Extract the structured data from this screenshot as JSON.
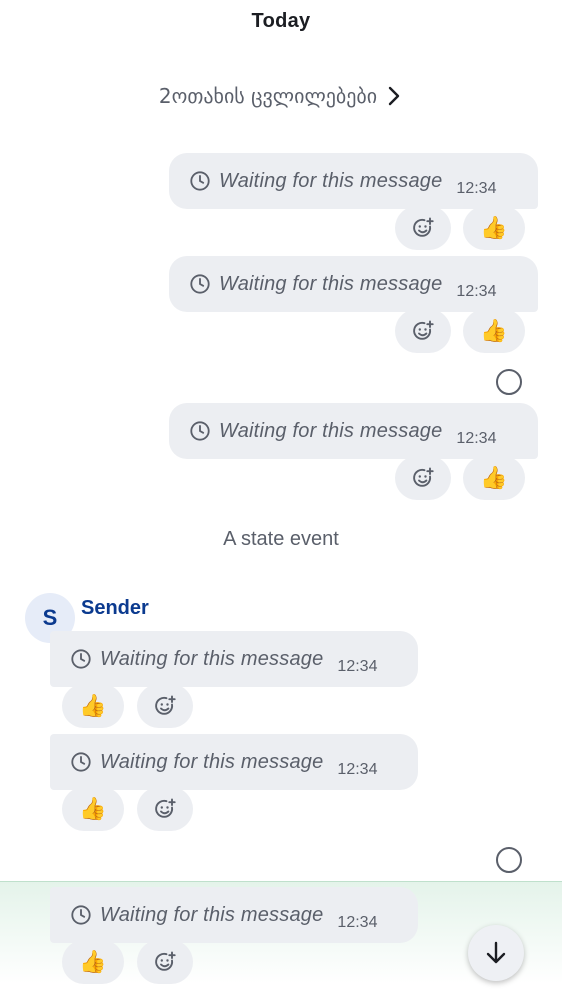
{
  "timeline": {
    "day_separator": "Today",
    "group_summary": "2ოთახის ცვლილებები",
    "state_event": "A state event",
    "sender_name": "Sender",
    "sender_initial": "S"
  },
  "messages": [
    {
      "text": "Waiting for this message",
      "time": "12:34",
      "reaction": "👍"
    },
    {
      "text": "Waiting for this message",
      "time": "12:34",
      "reaction": "👍"
    },
    {
      "text": "Waiting for this message",
      "time": "12:34",
      "reaction": "👍"
    },
    {
      "text": "Waiting for this message",
      "time": "12:34",
      "reaction": "👍"
    },
    {
      "text": "Waiting for this message",
      "time": "12:34",
      "reaction": "👍"
    },
    {
      "text": "Waiting for this message",
      "time": "12:34",
      "reaction": "👍"
    }
  ],
  "icons": {
    "pending": "clock-icon",
    "add_reaction": "add-reaction-icon",
    "expand": "chevron-right-icon",
    "read_receipt": "receipt-circle-icon",
    "scroll": "arrow-down-icon"
  },
  "colors": {
    "bubble": "#eceef2",
    "sender": "#0b3a8f",
    "secondary_text": "#5a5f6a"
  }
}
